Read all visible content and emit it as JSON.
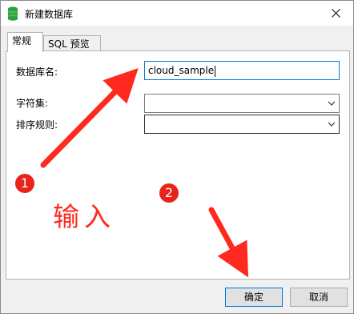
{
  "window": {
    "title": "新建数据库",
    "close_icon": "close-icon",
    "app_icon": "database-icon"
  },
  "tabs": [
    {
      "label": "常规",
      "active": true
    },
    {
      "label": "SQL 预览",
      "active": false
    }
  ],
  "form": {
    "db_name_label": "数据库名:",
    "db_name_value": "cloud_sample",
    "charset_label": "字符集:",
    "charset_value": "",
    "collation_label": "排序规则:",
    "collation_value": ""
  },
  "buttons": {
    "ok": "确定",
    "cancel": "取消"
  },
  "annotations": {
    "marker_1": "1",
    "marker_2": "2",
    "text": "输入",
    "color": "#e8231c"
  },
  "colors": {
    "focus_border": "#0078d7",
    "button_bg": "#e1e1e1"
  }
}
